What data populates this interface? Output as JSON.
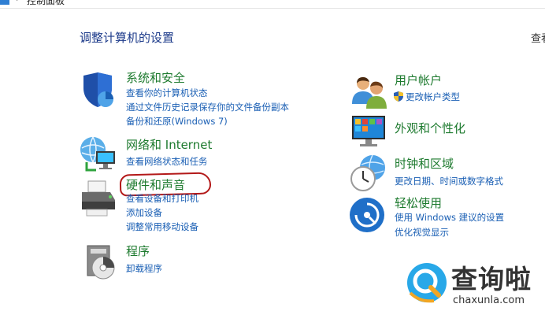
{
  "address_bar": {
    "path": "控制面板"
  },
  "page": {
    "title": "调整计算机的设置",
    "view_by": "查看"
  },
  "categories": [
    {
      "title": "系统和安全",
      "icon": "shield-icon",
      "links": [
        "查看你的计算机状态",
        "通过文件历史记录保存你的文件备份副本",
        "备份和还原(Windows 7)"
      ]
    },
    {
      "title": "网络和 Internet",
      "icon": "network-globe-icon",
      "links": [
        "查看网络状态和任务"
      ]
    },
    {
      "title": "硬件和声音",
      "icon": "printer-icon",
      "links": [
        "查看设备和打印机",
        "添加设备",
        "调整常用移动设备"
      ]
    },
    {
      "title": "程序",
      "icon": "programs-disc-icon",
      "links": [
        "卸载程序"
      ]
    },
    {
      "title": "用户帐户",
      "icon": "users-icon",
      "links": [
        "更改帐户类型"
      ]
    },
    {
      "title": "外观和个性化",
      "icon": "monitor-palette-icon",
      "links": []
    },
    {
      "title": "时钟和区域",
      "icon": "clock-globe-icon",
      "links": [
        "更改日期、时间或数字格式"
      ]
    },
    {
      "title": "轻松使用",
      "icon": "ease-of-access-icon",
      "links": [
        "使用 Windows 建议的设置",
        "优化视觉显示"
      ]
    }
  ],
  "watermark": {
    "brand": "查询啦",
    "url": "chaxunla.com"
  },
  "colors": {
    "title": "#1c3a8a",
    "category": "#1d7a2e",
    "link": "#1a5fb4",
    "mark": "#b31919"
  }
}
